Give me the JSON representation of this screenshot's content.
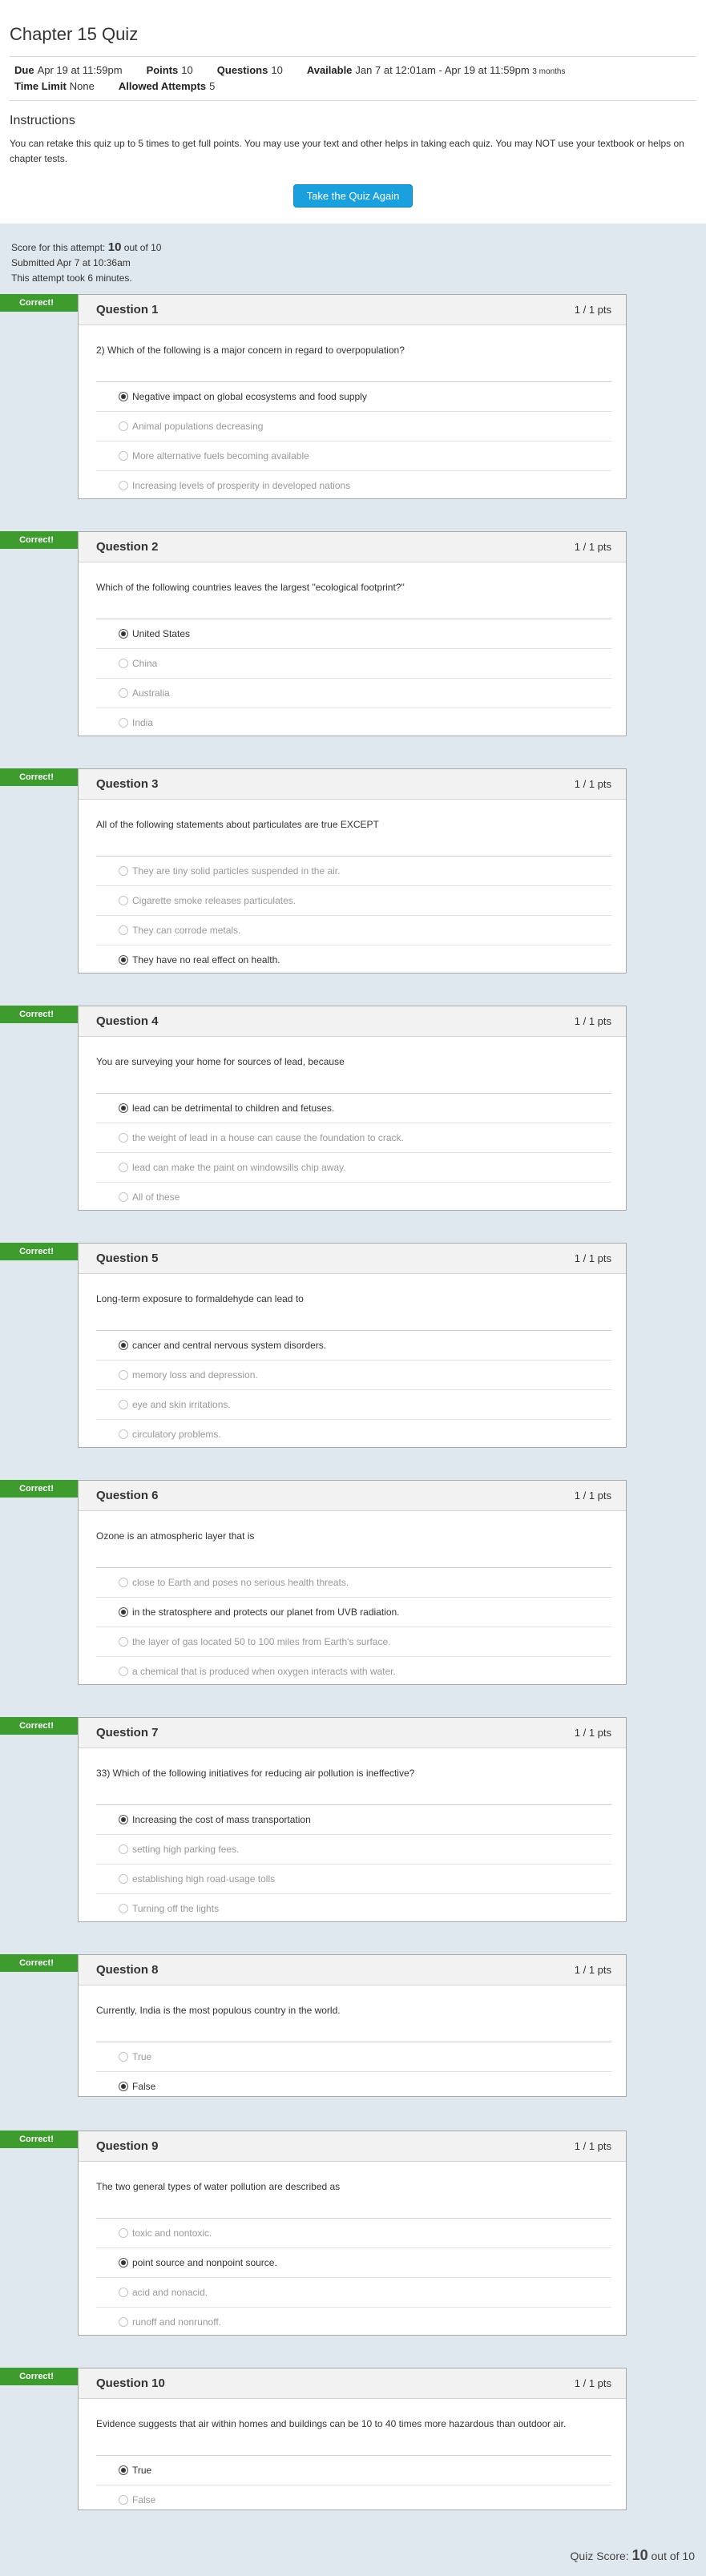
{
  "quiz": {
    "title": "Chapter 15 Quiz",
    "details": {
      "due_label": "Due",
      "due_value": "Apr 19 at 11:59pm",
      "points_label": "Points",
      "points_value": "10",
      "questions_label": "Questions",
      "questions_value": "10",
      "available_label": "Available",
      "available_value": "Jan 7 at 12:01am - Apr 19 at 11:59pm",
      "available_duration": "3 months",
      "time_limit_label": "Time Limit",
      "time_limit_value": "None",
      "attempts_label": "Allowed Attempts",
      "attempts_value": "5"
    },
    "instructions_title": "Instructions",
    "instructions_text": "You can retake this quiz up to 5 times to get full points.  You may use your text and other helps in taking each quiz.  You may NOT use your textbook or helps on chapter tests.",
    "take_again_label": "Take the Quiz Again",
    "score_prefix": "Score for this attempt:",
    "score_value": "10",
    "score_suffix": "out of 10",
    "submitted": "Submitted Apr 7 at 10:36am",
    "duration": "This attempt took 6 minutes.",
    "final_score_label": "Quiz Score:",
    "final_score_value": "10",
    "final_score_suffix": "out of 10"
  },
  "questions": [
    {
      "flag": "Correct!",
      "title": "Question 1",
      "pts": "1 / 1 pts",
      "text": "2) Which of the following is a major concern in regard to overpopulation?",
      "answers": [
        "Negative impact on global ecosystems and food supply",
        "Animal populations decreasing",
        "More alternative fuels becoming available",
        "Increasing levels of prosperity in developed nations"
      ],
      "selected": 0
    },
    {
      "flag": "Correct!",
      "title": "Question 2",
      "pts": "1 / 1 pts",
      "text": "Which of the following countries leaves the largest \"ecological footprint?\"",
      "answers": [
        "United States",
        "China",
        "Australia",
        "India"
      ],
      "selected": 0
    },
    {
      "flag": "Correct!",
      "title": "Question 3",
      "pts": "1 / 1 pts",
      "text": "All of the following statements about particulates are true EXCEPT",
      "answers": [
        "They are tiny solid particles suspended in the air.",
        "Cigarette smoke releases particulates.",
        "They can corrode metals.",
        "They have no real effect on health."
      ],
      "selected": 3
    },
    {
      "flag": "Correct!",
      "title": "Question 4",
      "pts": "1 / 1 pts",
      "text": "You are surveying your home for sources of lead, because",
      "answers": [
        "lead can be detrimental to children and fetuses.",
        "the weight of lead in a house can cause the foundation to crack.",
        "lead can make the paint on windowsills chip away.",
        "All of these"
      ],
      "selected": 0
    },
    {
      "flag": "Correct!",
      "title": "Question 5",
      "pts": "1 / 1 pts",
      "text": "Long-term exposure to formaldehyde can lead to",
      "answers": [
        "cancer and central nervous system disorders.",
        "memory loss and depression.",
        "eye and skin irritations.",
        "circulatory problems."
      ],
      "selected": 0
    },
    {
      "flag": "Correct!",
      "title": "Question 6",
      "pts": "1 / 1 pts",
      "text": "Ozone is an atmospheric layer that is",
      "answers": [
        "close to Earth and poses no serious health threats.",
        "in the stratosphere and protects our planet from UVB radiation.",
        "the layer of gas located 50 to 100 miles from Earth's surface.",
        "a chemical that is produced when oxygen interacts with water."
      ],
      "selected": 1
    },
    {
      "flag": "Correct!",
      "title": "Question 7",
      "pts": "1 / 1 pts",
      "text": "33) Which of the following initiatives for reducing air pollution is ineffective?",
      "answers": [
        "Increasing the cost of mass transportation",
        "setting high parking fees.",
        "establishing high road-usage tolls",
        "Turning off the lights"
      ],
      "selected": 0
    },
    {
      "flag": "Correct!",
      "title": "Question 8",
      "pts": "1 / 1 pts",
      "text": "Currently, India is the most populous country in the world.",
      "answers": [
        "True",
        "False"
      ],
      "selected": 1
    },
    {
      "flag": "Correct!",
      "title": "Question 9",
      "pts": "1 / 1 pts",
      "text": "The two general types of water pollution are described as",
      "answers": [
        "toxic and nontoxic.",
        "point source and nonpoint source.",
        "acid and nonacid.",
        "runoff and nonrunoff."
      ],
      "selected": 1
    },
    {
      "flag": "Correct!",
      "title": "Question 10",
      "pts": "1 / 1 pts",
      "text": "Evidence suggests that air within homes and buildings can be 10 to 40 times more hazardous than outdoor air.",
      "answers": [
        "True",
        "False"
      ],
      "selected": 0
    }
  ]
}
